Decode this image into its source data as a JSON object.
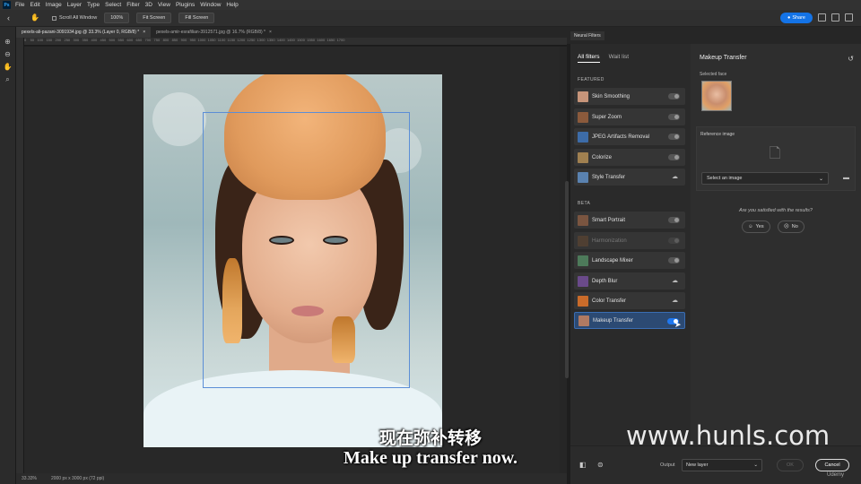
{
  "menubar": {
    "logo": "Ps",
    "items": [
      "File",
      "Edit",
      "Image",
      "Layer",
      "Type",
      "Select",
      "Filter",
      "3D",
      "View",
      "Plugins",
      "Window",
      "Help"
    ]
  },
  "options": {
    "scroll_all": "Scroll All Window",
    "zoom": "100%",
    "fit1": "Fit Screen",
    "fit2": "Fill Screen",
    "share": "Share"
  },
  "doc_tabs": [
    {
      "label": "pexels-ali-pazani-3091934.jpg @ 33.3% (Layer 0, RGB/8) *",
      "close": "×"
    },
    {
      "label": "pexels-amir-esrafilian-3912571.jpg @ 16.7% (RGB/8) *",
      "close": "×"
    }
  ],
  "ruler_ticks": "0    50   100   150   200   250   300   350   400   450   500   550   600   650   700   750   800   850   900   950  1000  1050  1100  1150  1200  1250  1300  1350  1400  1450  1500  1550  1600  1650  1700",
  "status": {
    "zoom": "33.33%",
    "size": "2000 px x 3000 px (72 ppi)"
  },
  "panel": {
    "tab": "Neural Filters",
    "filter_tabs": [
      "All filters",
      "Wait list"
    ],
    "featured_label": "FEATURED",
    "beta_label": "BETA",
    "featured": [
      {
        "name": "Skin Smoothing",
        "state": "toggle"
      },
      {
        "name": "Super Zoom",
        "state": "toggle"
      },
      {
        "name": "JPEG Artifacts Removal",
        "state": "toggle"
      },
      {
        "name": "Colorize",
        "state": "toggle"
      },
      {
        "name": "Style Transfer",
        "state": "cloud"
      }
    ],
    "beta": [
      {
        "name": "Smart Portrait",
        "state": "toggle"
      },
      {
        "name": "Harmonization",
        "state": "toggle-dim"
      },
      {
        "name": "Landscape Mixer",
        "state": "toggle"
      },
      {
        "name": "Depth Blur",
        "state": "cloud"
      },
      {
        "name": "Color Transfer",
        "state": "cloud"
      },
      {
        "name": "Makeup Transfer",
        "state": "toggle-on"
      }
    ],
    "settings": {
      "title": "Makeup Transfer",
      "selected_face": "Selected face",
      "reference_image": "Reference image",
      "select_placeholder": "Select an image",
      "satisfied": "Are you satisfied with the results?",
      "yes": "Yes",
      "no": "No"
    },
    "footer": {
      "output_label": "Output",
      "output_value": "New layer",
      "ok": "OK",
      "cancel": "Cancel"
    }
  },
  "overlay": {
    "subtitle_cn": "现在弥补转移",
    "subtitle_en": "Make up transfer now.",
    "watermark": "www.hunls.com",
    "udemy": "Udemy"
  },
  "colors": {
    "accent": "#1473e6",
    "selected_row": "#2c4a73",
    "face_box": "#5b8ed6"
  }
}
